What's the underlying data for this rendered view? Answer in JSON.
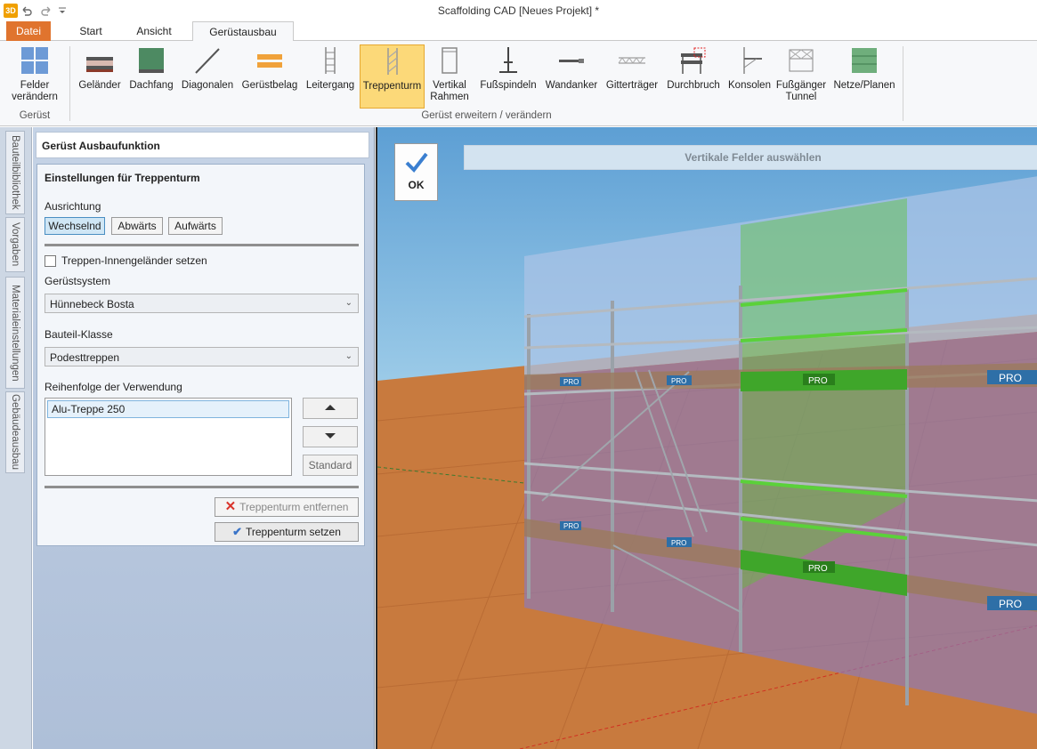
{
  "window": {
    "title": "Scaffolding CAD [Neues Projekt] *",
    "app_icon": "3D"
  },
  "quick_access": {
    "undo_icon": "undo-icon",
    "redo_icon": "redo-icon",
    "customize_icon": "customize-icon"
  },
  "tabs": {
    "datei": "Datei",
    "start": "Start",
    "ansicht": "Ansicht",
    "geruest": "Gerüstausbau"
  },
  "ribbon": {
    "felder_line1": "Felder",
    "felder_line2": "verändern",
    "group_geruest": "Gerüst",
    "buttons": [
      {
        "label": "Geländer"
      },
      {
        "label": "Dachfang"
      },
      {
        "label": "Diagonalen"
      },
      {
        "label": "Gerüstbelag"
      },
      {
        "label": "Leitergang"
      },
      {
        "label": "Treppenturm"
      },
      {
        "label": "Vertikal"
      },
      {
        "label": "Fußspindeln"
      },
      {
        "label": "Wandanker"
      },
      {
        "label": "Gitterträger"
      },
      {
        "label": "Durchbruch"
      },
      {
        "label": "Konsolen"
      },
      {
        "label": "Fußgänger"
      },
      {
        "label": "Netze/Planen"
      }
    ],
    "vertikal_line2": "Rahmen",
    "fussgaenger_line2": "Tunnel",
    "group_erweitern": "Gerüst erweitern / verändern"
  },
  "side_tabs": [
    "Bauteilbibliothek",
    "Vorgaben",
    "Materialeinstellungen",
    "Gebäudeausbau"
  ],
  "panel": {
    "header": "Gerüst Ausbaufunktion",
    "settings_title": "Einstellungen für Treppenturm",
    "ausrichtung_label": "Ausrichtung",
    "ausrichtung_options": [
      "Wechselnd",
      "Abwärts",
      "Aufwärts"
    ],
    "ausrichtung_selected": "Wechselnd",
    "innengelaender_label": "Treppen-Innengeländer setzen",
    "innengelaender_checked": false,
    "system_label": "Gerüstsystem",
    "system_value": "Hünnebeck Bosta",
    "klasse_label": "Bauteil-Klasse",
    "klasse_value": "Podesttreppen",
    "reihenfolge_label": "Reihenfolge der Verwendung",
    "reihenfolge_items": [
      "Alu-Treppe 250"
    ],
    "up_icon": "arrow-up-icon",
    "down_icon": "arrow-down-icon",
    "standard_label": "Standard",
    "remove_label": "Treppenturm entfernen",
    "set_label": "Treppenturm setzen"
  },
  "viewport": {
    "ok_label": "OK",
    "hint": "Vertikale Felder auswählen",
    "brand_label": "PRO",
    "colors": {
      "floor": "#c87a3e",
      "highlight": "#5fc23a",
      "wall_overlay": "#8b7bbd"
    }
  }
}
